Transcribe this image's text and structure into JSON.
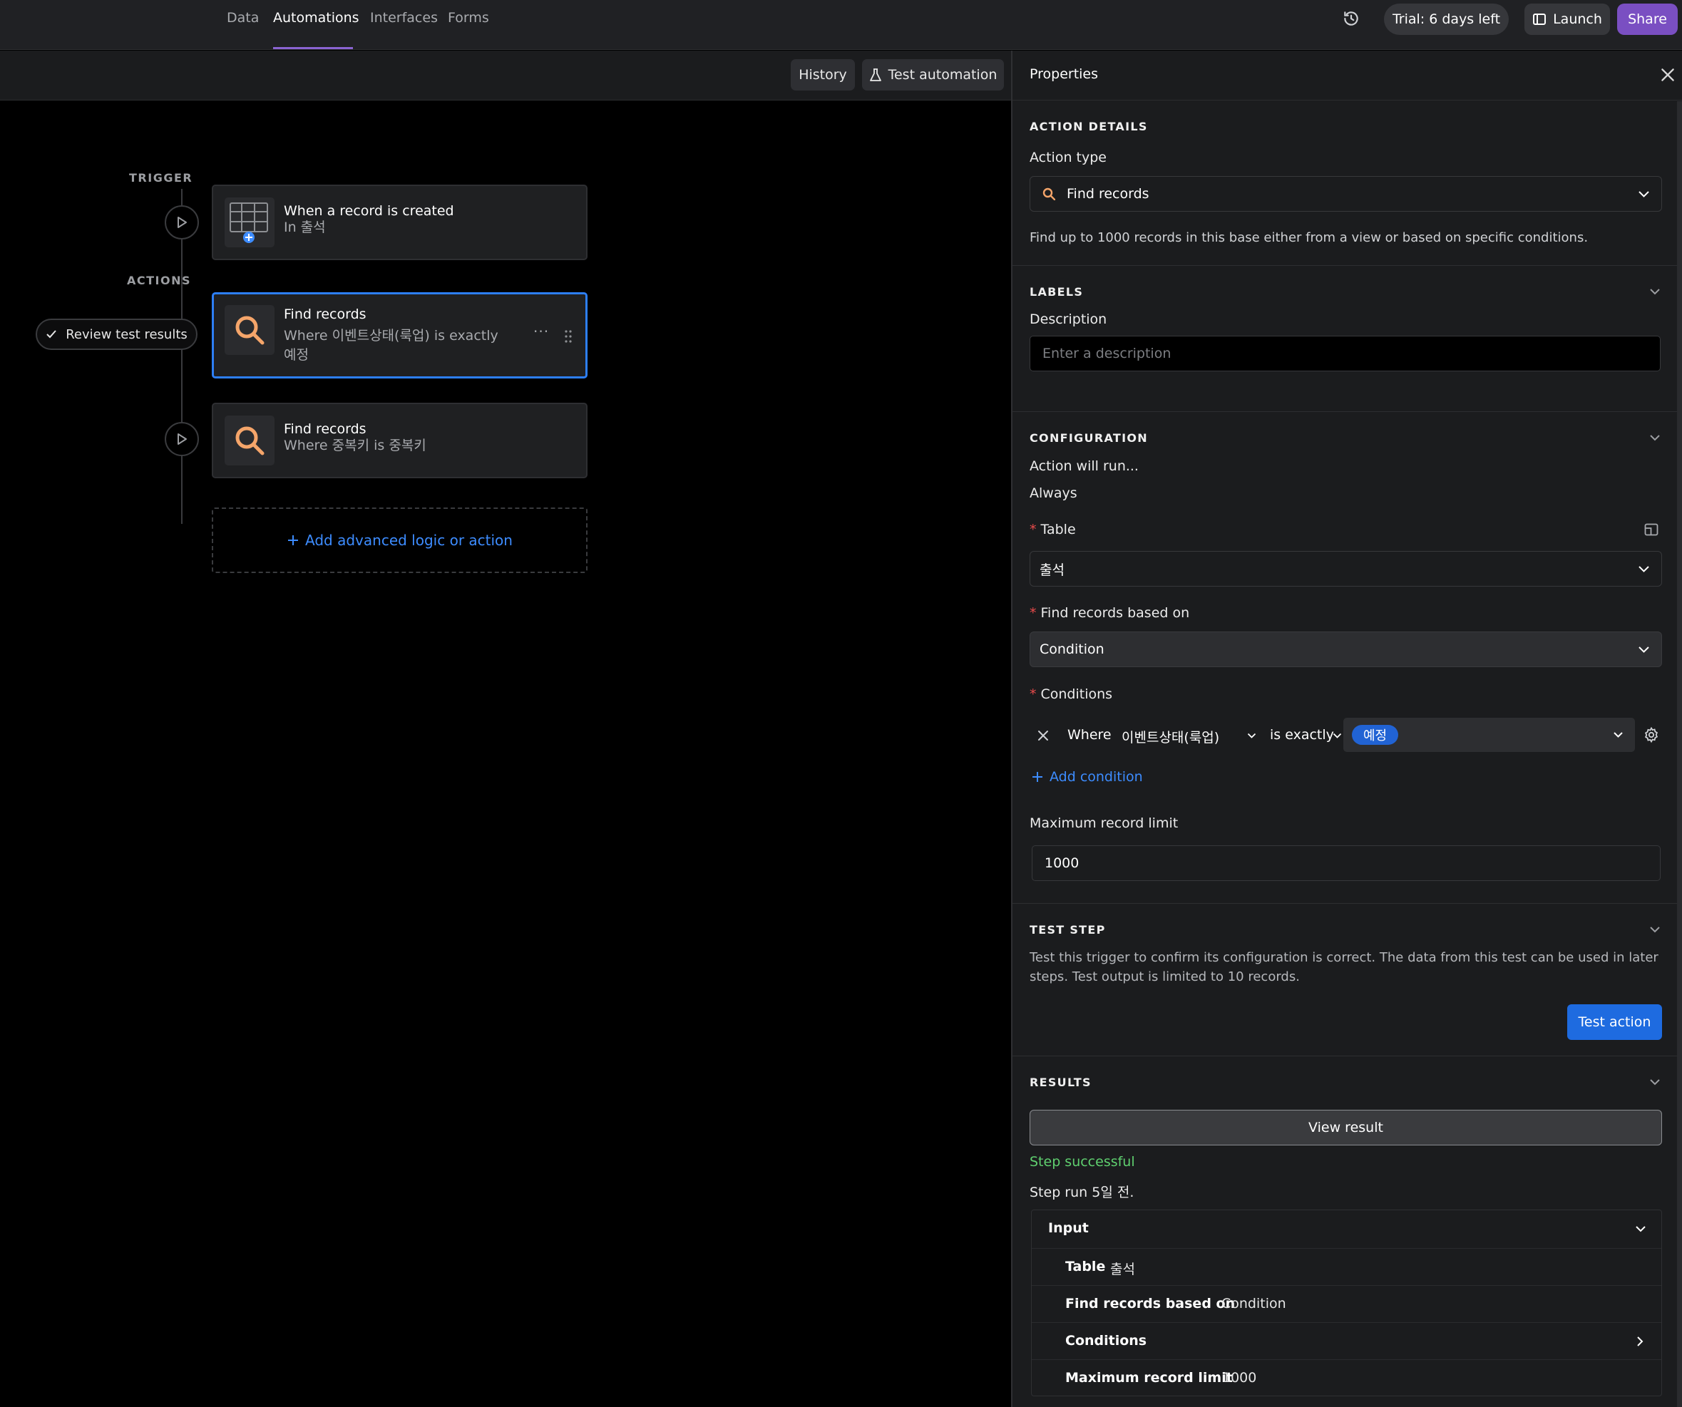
{
  "nav": {
    "tabs": [
      "Data",
      "Automations",
      "Interfaces",
      "Forms"
    ],
    "active_tab": "Automations",
    "trial": "Trial: 6 days left",
    "launch": "Launch",
    "share": "Share"
  },
  "toolbar": {
    "history": "History",
    "test_automation": "Test automation"
  },
  "flow": {
    "trigger_label": "TRIGGER",
    "actions_label": "ACTIONS",
    "review_pill": "Review test results",
    "trigger_card": {
      "title": "When a record is created",
      "subtitle": "In 출석"
    },
    "action1": {
      "title": "Find records",
      "subtitle_line1": "Where 이벤트상태(룩업) is exactly",
      "subtitle_line2": "예정"
    },
    "action2": {
      "title": "Find records",
      "subtitle": "Where 중복키 is 중복키"
    },
    "add_logic": "Add advanced logic or action"
  },
  "panel": {
    "title": "Properties",
    "action_details": {
      "heading": "ACTION DETAILS",
      "action_type_label": "Action type",
      "action_type_value": "Find records",
      "description": "Find up to 1000 records in this base either from a view or based on specific conditions."
    },
    "labels": {
      "heading": "LABELS",
      "description_label": "Description",
      "description_placeholder": "Enter a description"
    },
    "configuration": {
      "heading": "CONFIGURATION",
      "run_label": "Action will run...",
      "run_value": "Always",
      "table_label": "Table",
      "table_value": "출석",
      "based_on_label": "Find records based on",
      "based_on_value": "Condition",
      "conditions_label": "Conditions",
      "condition": {
        "where": "Where",
        "field": "이벤트상태(룩업)",
        "operator": "is exactly",
        "value": "예정"
      },
      "add_condition": "Add condition",
      "max_label": "Maximum record limit",
      "max_value": "1000"
    },
    "test_step": {
      "heading": "TEST STEP",
      "text_line1": "Test this trigger to confirm its configuration is correct. The data from this test can be used in later",
      "text_line2": "steps. Test output is limited to 10 records.",
      "button": "Test action"
    },
    "results": {
      "heading": "RESULTS",
      "view_result": "View result",
      "status": "Step successful",
      "run_time": "Step run 5일 전.",
      "input_label": "Input",
      "rows": [
        {
          "key": "Table",
          "value": "출석"
        },
        {
          "key": "Find records based on",
          "value": "Condition"
        },
        {
          "key": "Conditions",
          "value": ""
        },
        {
          "key": "Maximum record limit",
          "value": "1000"
        }
      ]
    }
  },
  "colors": {
    "accent": "#2d7ff9",
    "brand": "#7a4fc2",
    "success": "#5fcf6f",
    "search_icon": "#f5a56a"
  }
}
